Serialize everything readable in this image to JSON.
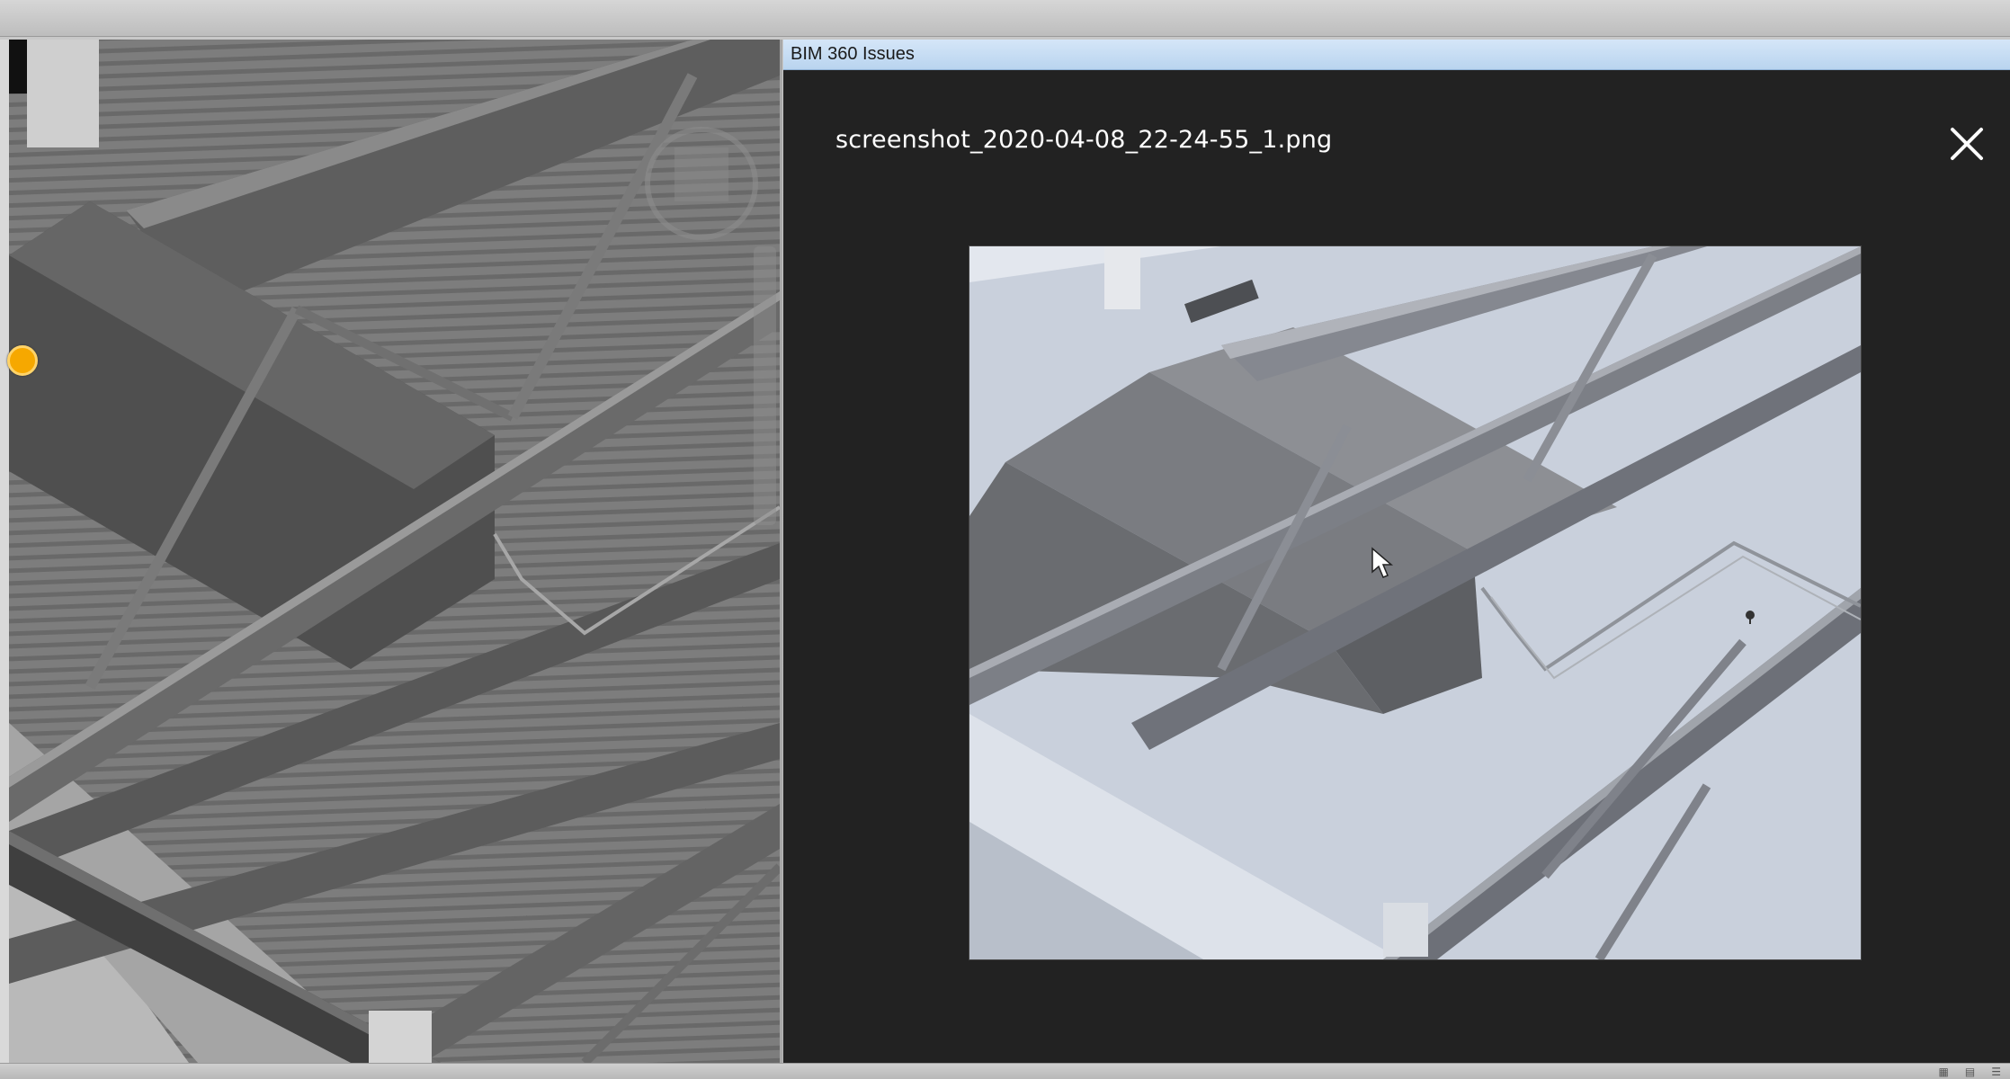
{
  "panel": {
    "title": "BIM 360 Issues"
  },
  "viewer": {
    "file_name": "screenshot_2020-04-08_22-24-55_1.png",
    "close_icon": "close-icon"
  },
  "viewport": {
    "marker_color": "#f6a800"
  },
  "colors": {
    "panel_bg": "#222222",
    "titlebar_bg": "#c8ddf4",
    "accent_marker": "#f6a800"
  }
}
